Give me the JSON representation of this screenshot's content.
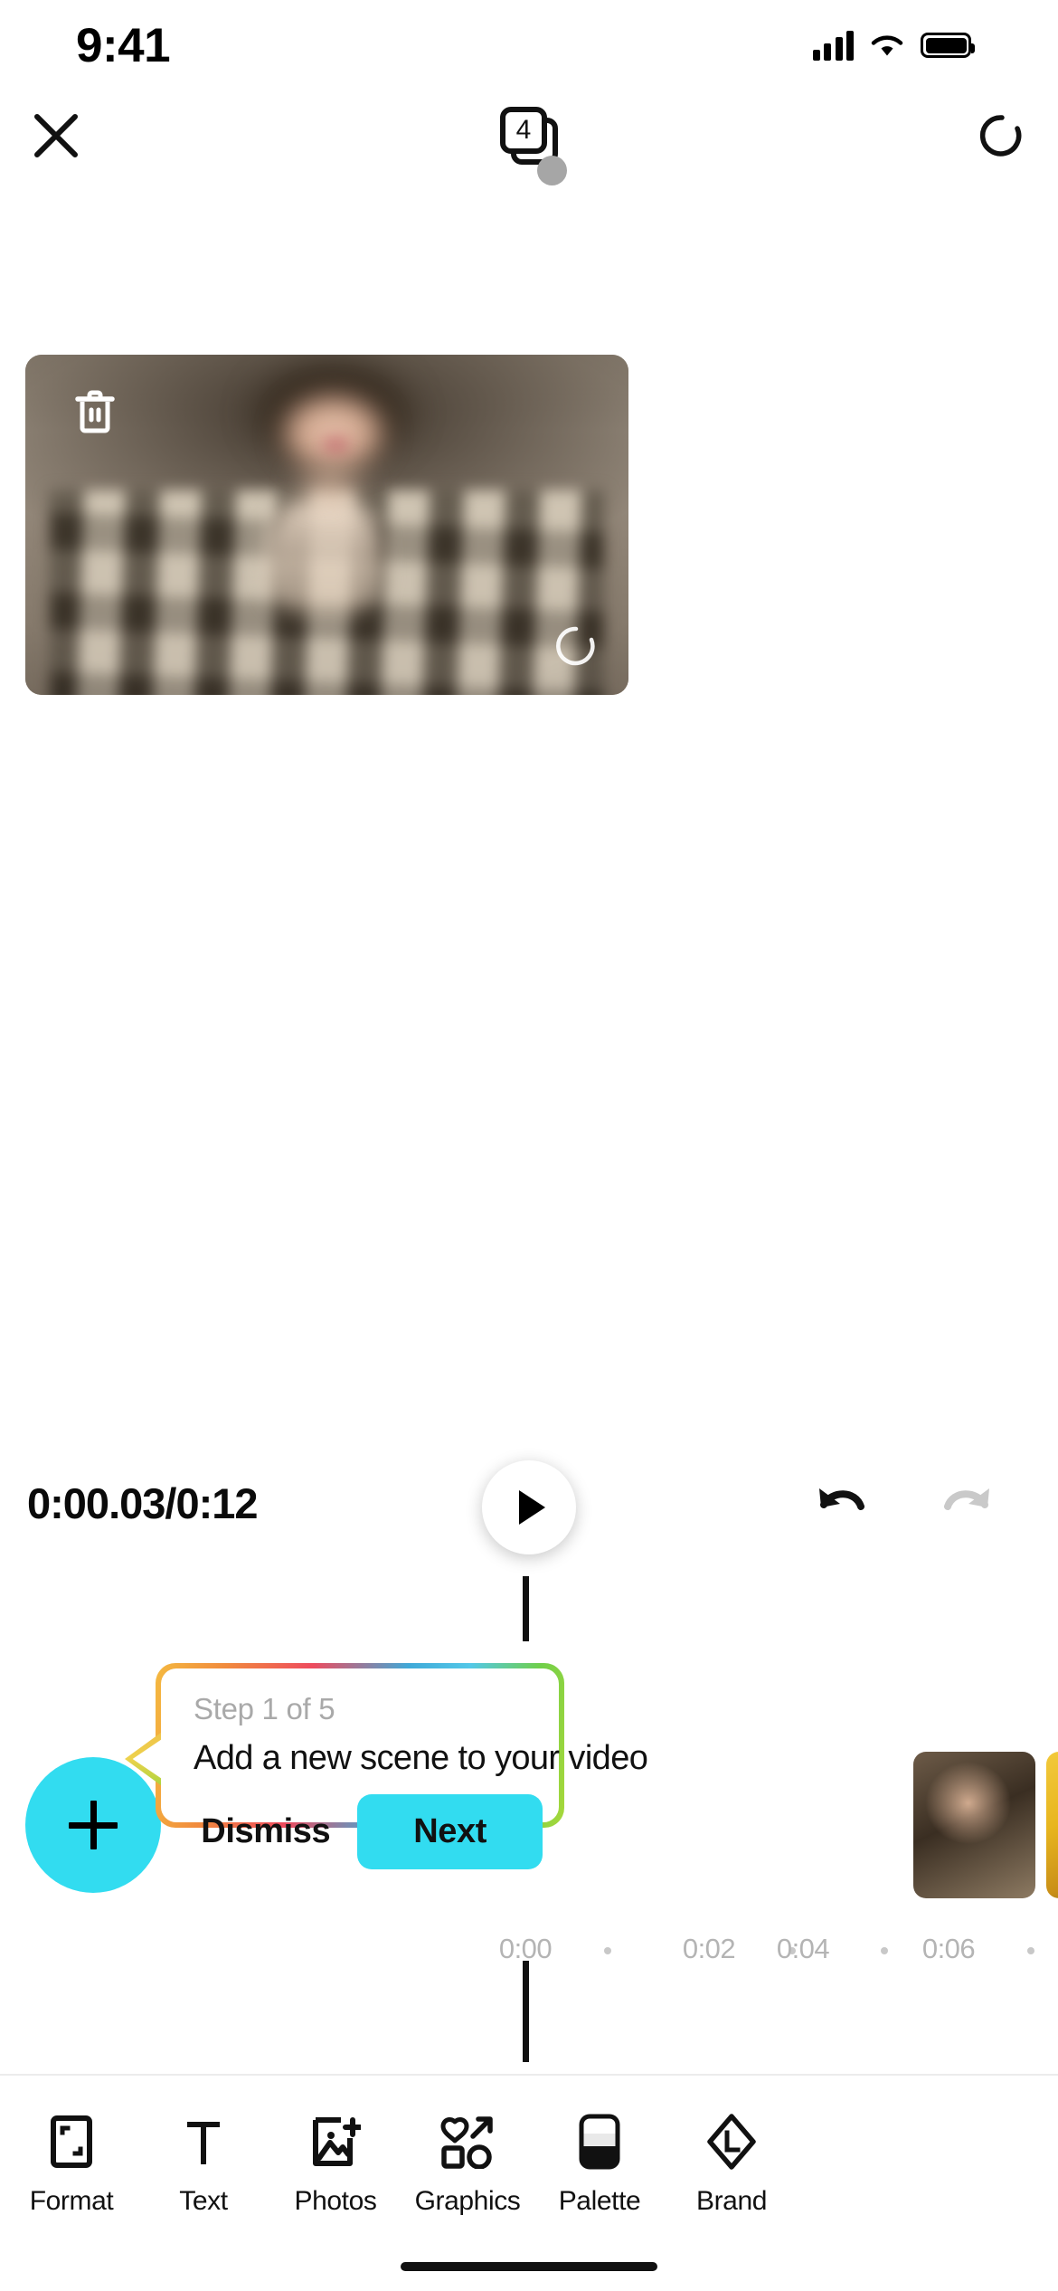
{
  "status_bar": {
    "time": "9:41",
    "cellular_icon": "cellular-bars-icon",
    "wifi_icon": "wifi-icon",
    "battery_icon": "battery-full-icon"
  },
  "nav_bar": {
    "close_icon": "close-x-icon",
    "scene_count": "4",
    "scenes_icon": "stacked-scenes-icon",
    "reset_icon": "reset-circular-arrow-icon"
  },
  "canvas": {
    "delete_icon": "trash-icon",
    "loading_icon": "loading-spinner-icon"
  },
  "controls": {
    "time_display": "0:00.03/0:12",
    "current_time": "0:00.03",
    "total_time": "0:12",
    "play_icon": "play-icon",
    "undo_icon": "undo-icon",
    "redo_icon": "redo-icon"
  },
  "timeline": {
    "add_scene_icon": "plus-icon",
    "ruler_ticks": [
      "0:00",
      "0:02",
      "0:04",
      "0:06"
    ],
    "clips": [
      {
        "name": "clip-thumbnail-1"
      },
      {
        "name": "clip-thumbnail-2"
      }
    ]
  },
  "tooltip": {
    "step_label": "Step 1 of 5",
    "title": "Add a new scene to your video",
    "dismiss_label": "Dismiss",
    "next_label": "Next",
    "accent_color": "#32dcf0"
  },
  "toolbar": {
    "items": [
      {
        "label": "Format",
        "icon": "format-frame-icon"
      },
      {
        "label": "Text",
        "icon": "text-t-icon"
      },
      {
        "label": "Photos",
        "icon": "photo-add-icon"
      },
      {
        "label": "Graphics",
        "icon": "graphics-shapes-icon"
      },
      {
        "label": "Palette",
        "icon": "palette-swatch-icon"
      },
      {
        "label": "Brand",
        "icon": "brand-hexagon-icon"
      }
    ]
  }
}
